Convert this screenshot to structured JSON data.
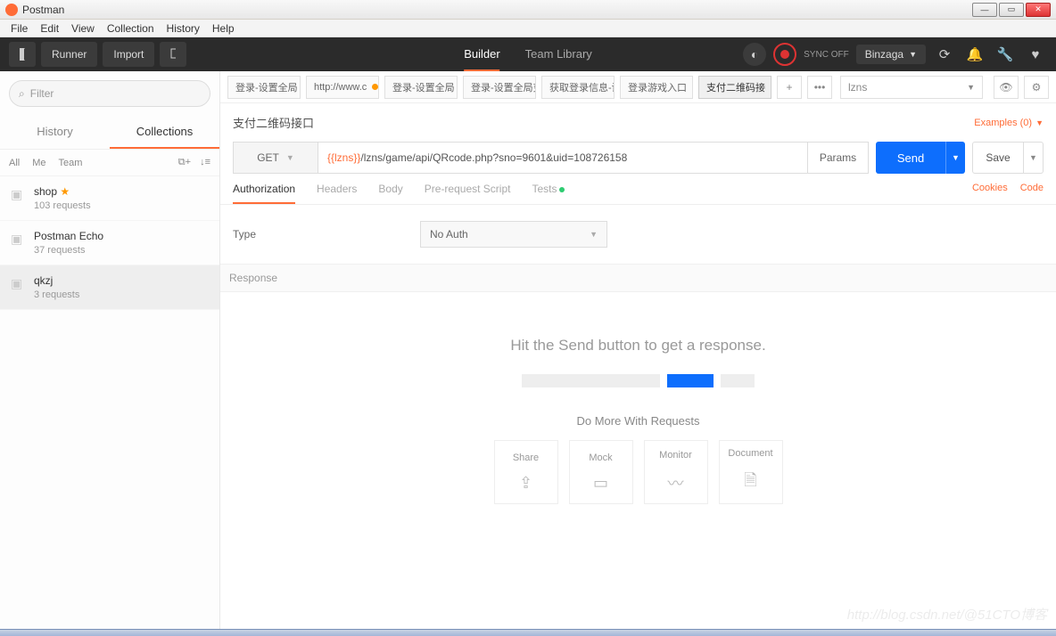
{
  "window": {
    "title": "Postman"
  },
  "menubar": [
    "File",
    "Edit",
    "View",
    "Collection",
    "History",
    "Help"
  ],
  "toolbar": {
    "runner": "Runner",
    "import": "Import",
    "builder": "Builder",
    "teamlib": "Team Library",
    "sync": "SYNC OFF",
    "user": "Binzaga"
  },
  "sidebar": {
    "filter_placeholder": "Filter",
    "tabs": {
      "history": "History",
      "collections": "Collections"
    },
    "filters": {
      "all": "All",
      "me": "Me",
      "team": "Team"
    },
    "collections": [
      {
        "name": "shop",
        "sub": "103 requests",
        "star": true
      },
      {
        "name": "Postman Echo",
        "sub": "37 requests",
        "star": false
      },
      {
        "name": "qkzj",
        "sub": "3 requests",
        "star": false
      }
    ]
  },
  "tabs": [
    {
      "label": "登录-设置全局",
      "dirty": true
    },
    {
      "label": "http://www.c",
      "dirty": true
    },
    {
      "label": "登录-设置全局",
      "dirty": true
    },
    {
      "label": "登录-设置全局变量",
      "dirty": false
    },
    {
      "label": "获取登录信息-设置",
      "dirty": false
    },
    {
      "label": "登录游戏入口",
      "dirty": true
    },
    {
      "label": "支付二维码接",
      "dirty": true,
      "active": true
    }
  ],
  "env": {
    "name": "lzns"
  },
  "request": {
    "name": "支付二维码接口",
    "examples": "Examples (0)",
    "method": "GET",
    "url_var": "{{lzns}}",
    "url_path": "/lzns/game/api/QRcode.php?sno=9601&uid=108726158",
    "params": "Params",
    "send": "Send",
    "save": "Save",
    "subtabs": {
      "auth": "Authorization",
      "headers": "Headers",
      "body": "Body",
      "prereq": "Pre-request Script",
      "tests": "Tests"
    },
    "links": {
      "cookies": "Cookies",
      "code": "Code"
    },
    "auth": {
      "type_label": "Type",
      "value": "No Auth"
    }
  },
  "response": {
    "header": "Response",
    "hint": "Hit the Send button to get a response.",
    "more": "Do More With Requests",
    "cards": [
      "Share",
      "Mock",
      "Monitor",
      "Document"
    ]
  },
  "watermark": "http://blog.csdn.net/@51CTO博客"
}
